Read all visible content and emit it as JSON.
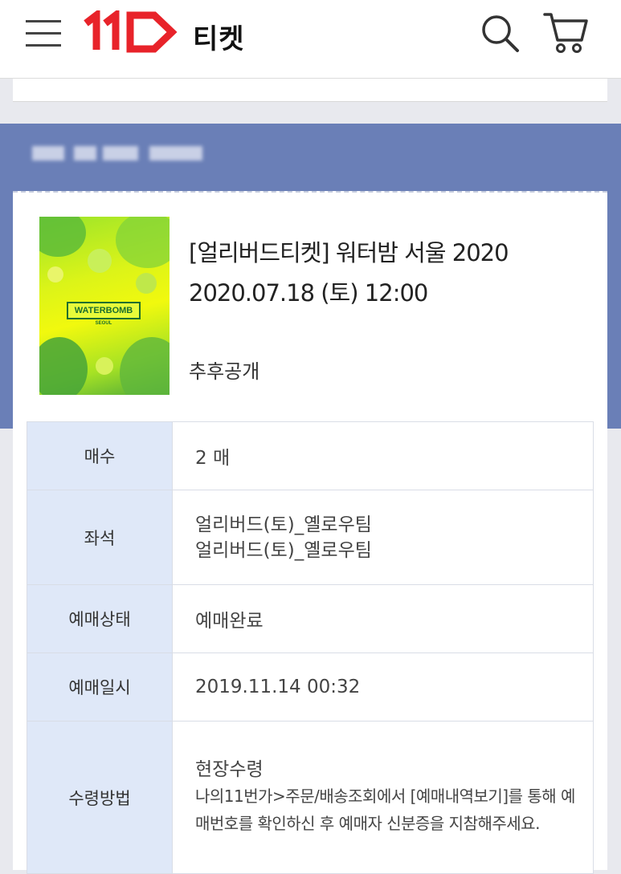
{
  "header": {
    "brand_text": "티켓",
    "logo_name": "11st-logo",
    "icons": {
      "menu": "hamburger-menu-icon",
      "search": "search-icon",
      "cart": "cart-icon"
    }
  },
  "event": {
    "title": "[얼리버드티켓] 워터밤 서울 2020",
    "datetime": "2020.07.18 (토) 12:00",
    "venue": "추후공개",
    "poster": {
      "logo_text": "WATERBOMB",
      "sub_text": "SEOUL"
    }
  },
  "details": {
    "quantity": {
      "label": "매수",
      "value": "2 매"
    },
    "seats": {
      "label": "좌석",
      "values": [
        "얼리버드(토)_옐로우팀",
        "얼리버드(토)_옐로우팀"
      ]
    },
    "status": {
      "label": "예매상태",
      "value": "예매완료"
    },
    "booked_at": {
      "label": "예매일시",
      "value": "2019.11.14 00:32"
    },
    "receive_method": {
      "label": "수령방법",
      "value": "현장수령",
      "note": "나의11번가>주문/배송조회에서 [예매내역보기]를 통해 예매번호를 확인하신 후 예매자 신분증을 지참해주세요."
    }
  },
  "colors": {
    "band": "#6a7fb7",
    "label_bg": "#dfe8f8",
    "status": "#e22d2d",
    "logo_red": "#e8232a"
  }
}
